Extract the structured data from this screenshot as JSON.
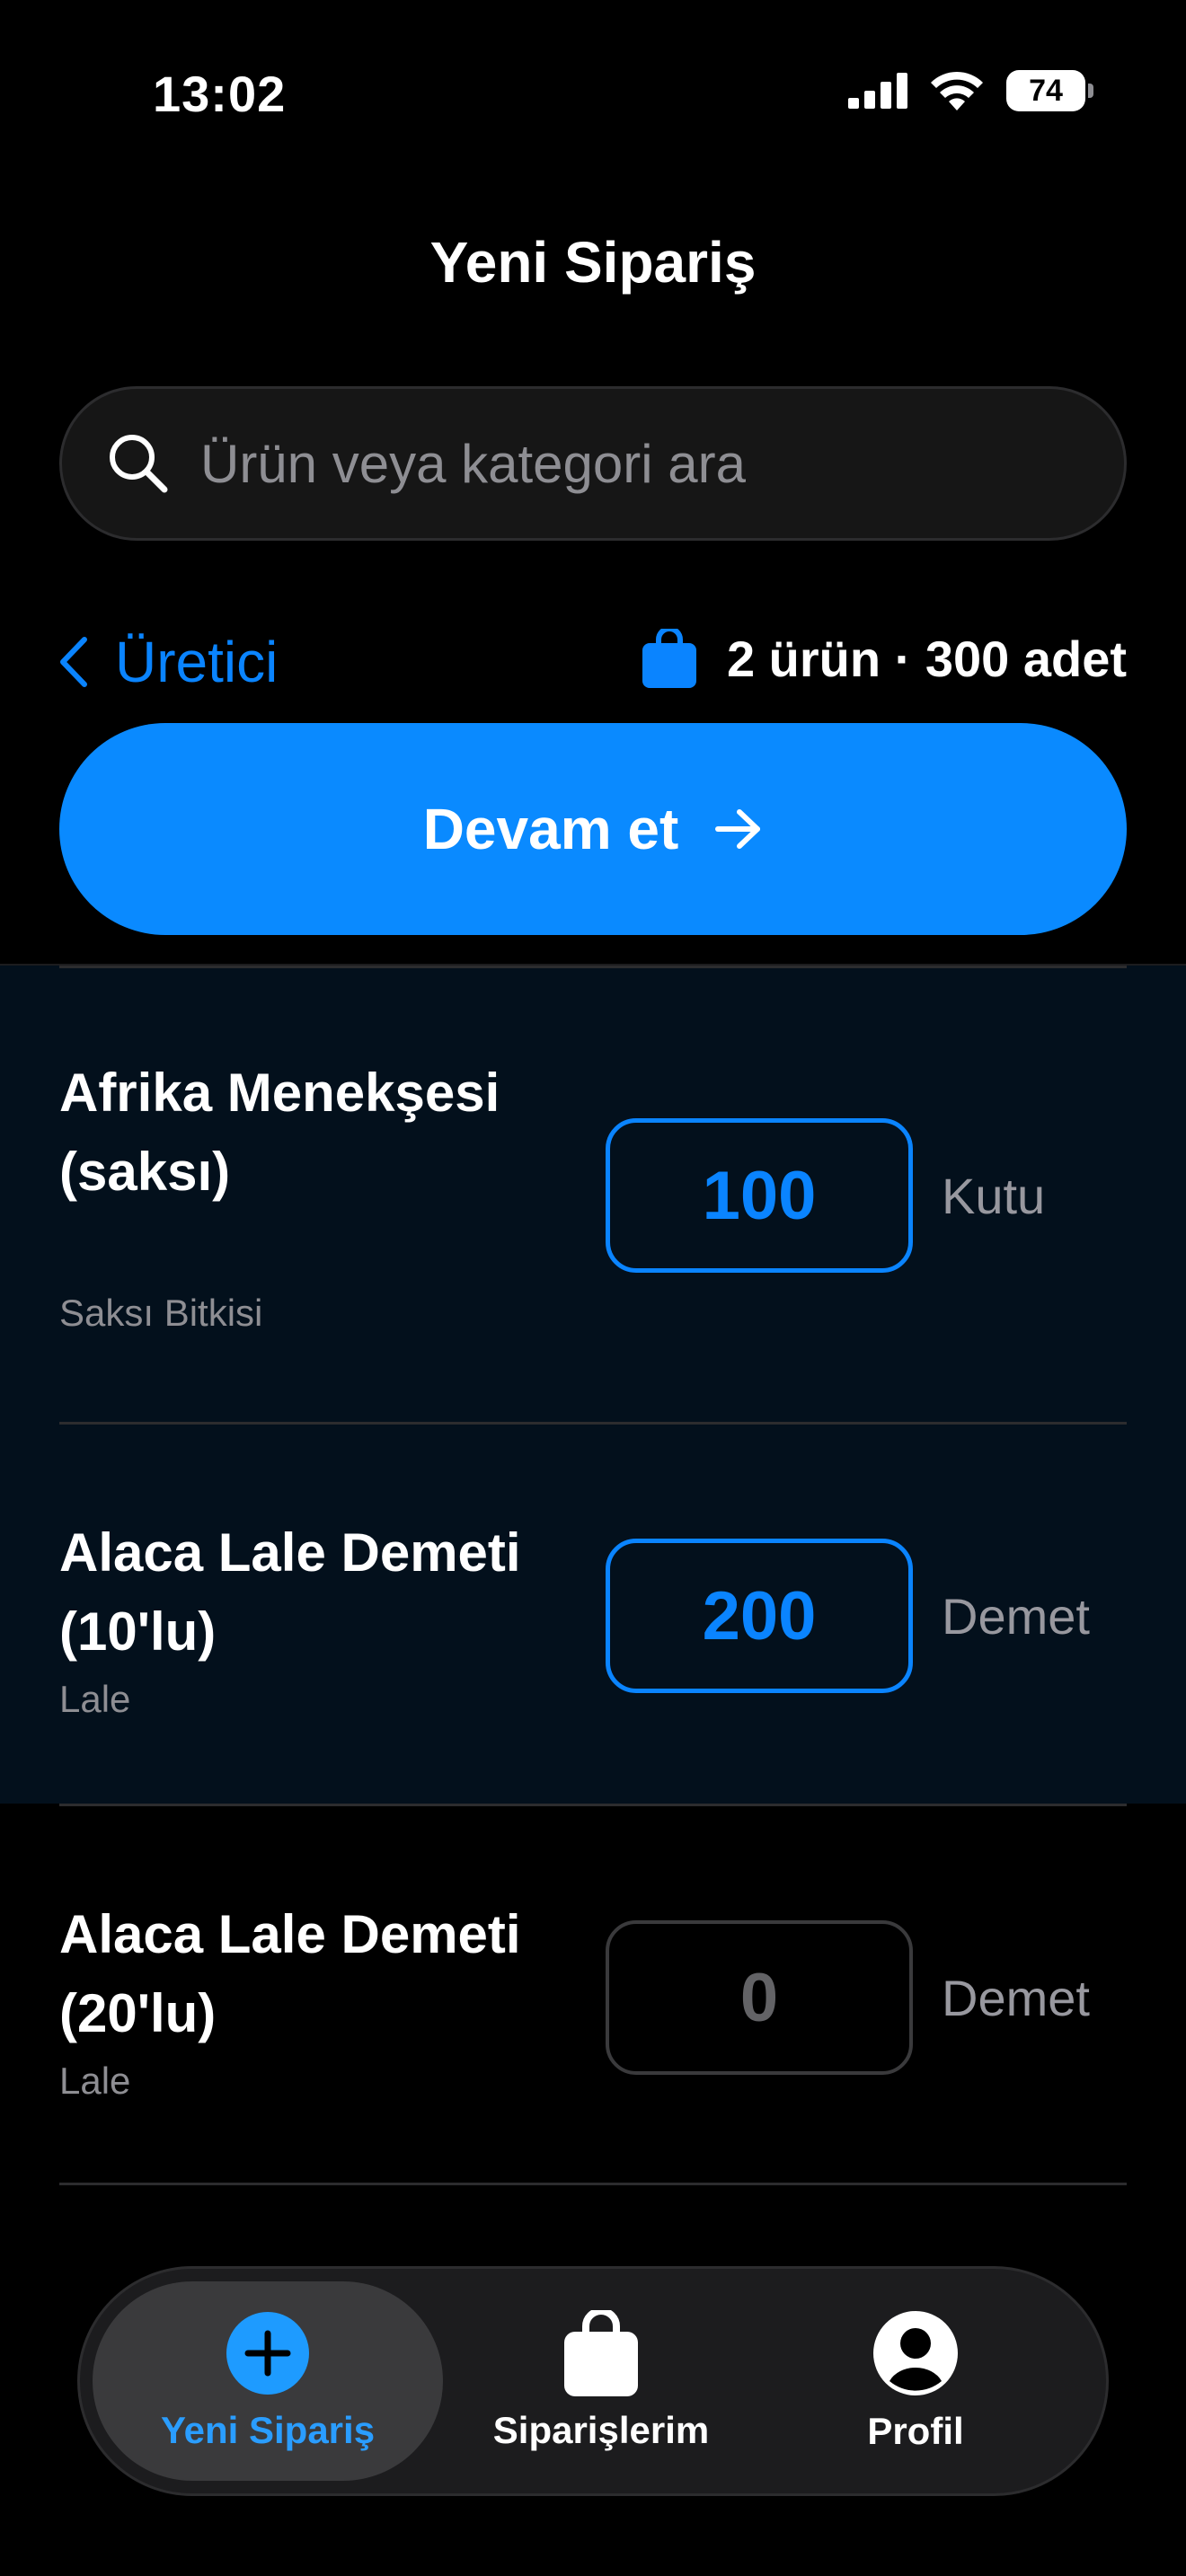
{
  "status_bar": {
    "time": "13:02",
    "battery": "74"
  },
  "nav": {
    "title": "Yeni Sipariş"
  },
  "search": {
    "placeholder": "Ürün veya kategori ara"
  },
  "back": {
    "label": "Üretici"
  },
  "summary": {
    "text": "2 ürün · 300 adet"
  },
  "cta": {
    "label": "Devam et"
  },
  "items": [
    {
      "name": "Afrika Menekşesi (saksı)",
      "category": "Saksı Bitkisi",
      "quantity": "100",
      "unit": "Kutu",
      "selected": true
    },
    {
      "name": "Alaca Lale Demeti (10'lu)",
      "category": "Lale",
      "quantity": "200",
      "unit": "Demet",
      "selected": true
    },
    {
      "name": "Alaca Lale Demeti (20'lu)",
      "category": "Lale",
      "quantity": "0",
      "unit": "Demet",
      "selected": false
    }
  ],
  "tab_bar": {
    "tabs": [
      {
        "label": "Yeni Sipariş",
        "icon": "plus-circle-icon",
        "active": true
      },
      {
        "label": "Siparişlerim",
        "icon": "bag-icon",
        "active": false
      },
      {
        "label": "Profil",
        "icon": "person-circle-icon",
        "active": false
      }
    ]
  },
  "colors": {
    "accent": "#0a84ff",
    "background": "#000000",
    "selected_row": "#03101c"
  }
}
